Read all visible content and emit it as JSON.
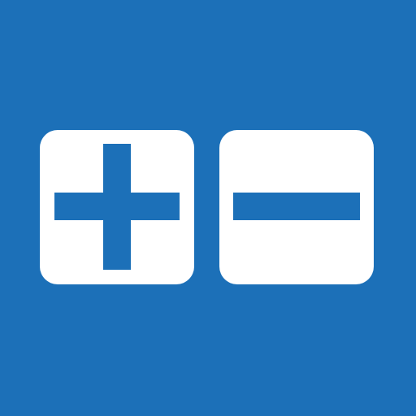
{
  "colors": {
    "background": "#1c70b8",
    "tile": "#ffffff",
    "symbol": "#1c70b8"
  },
  "buttons": [
    {
      "id": "plus",
      "icon": "plus-icon"
    },
    {
      "id": "minus",
      "icon": "minus-icon"
    }
  ]
}
